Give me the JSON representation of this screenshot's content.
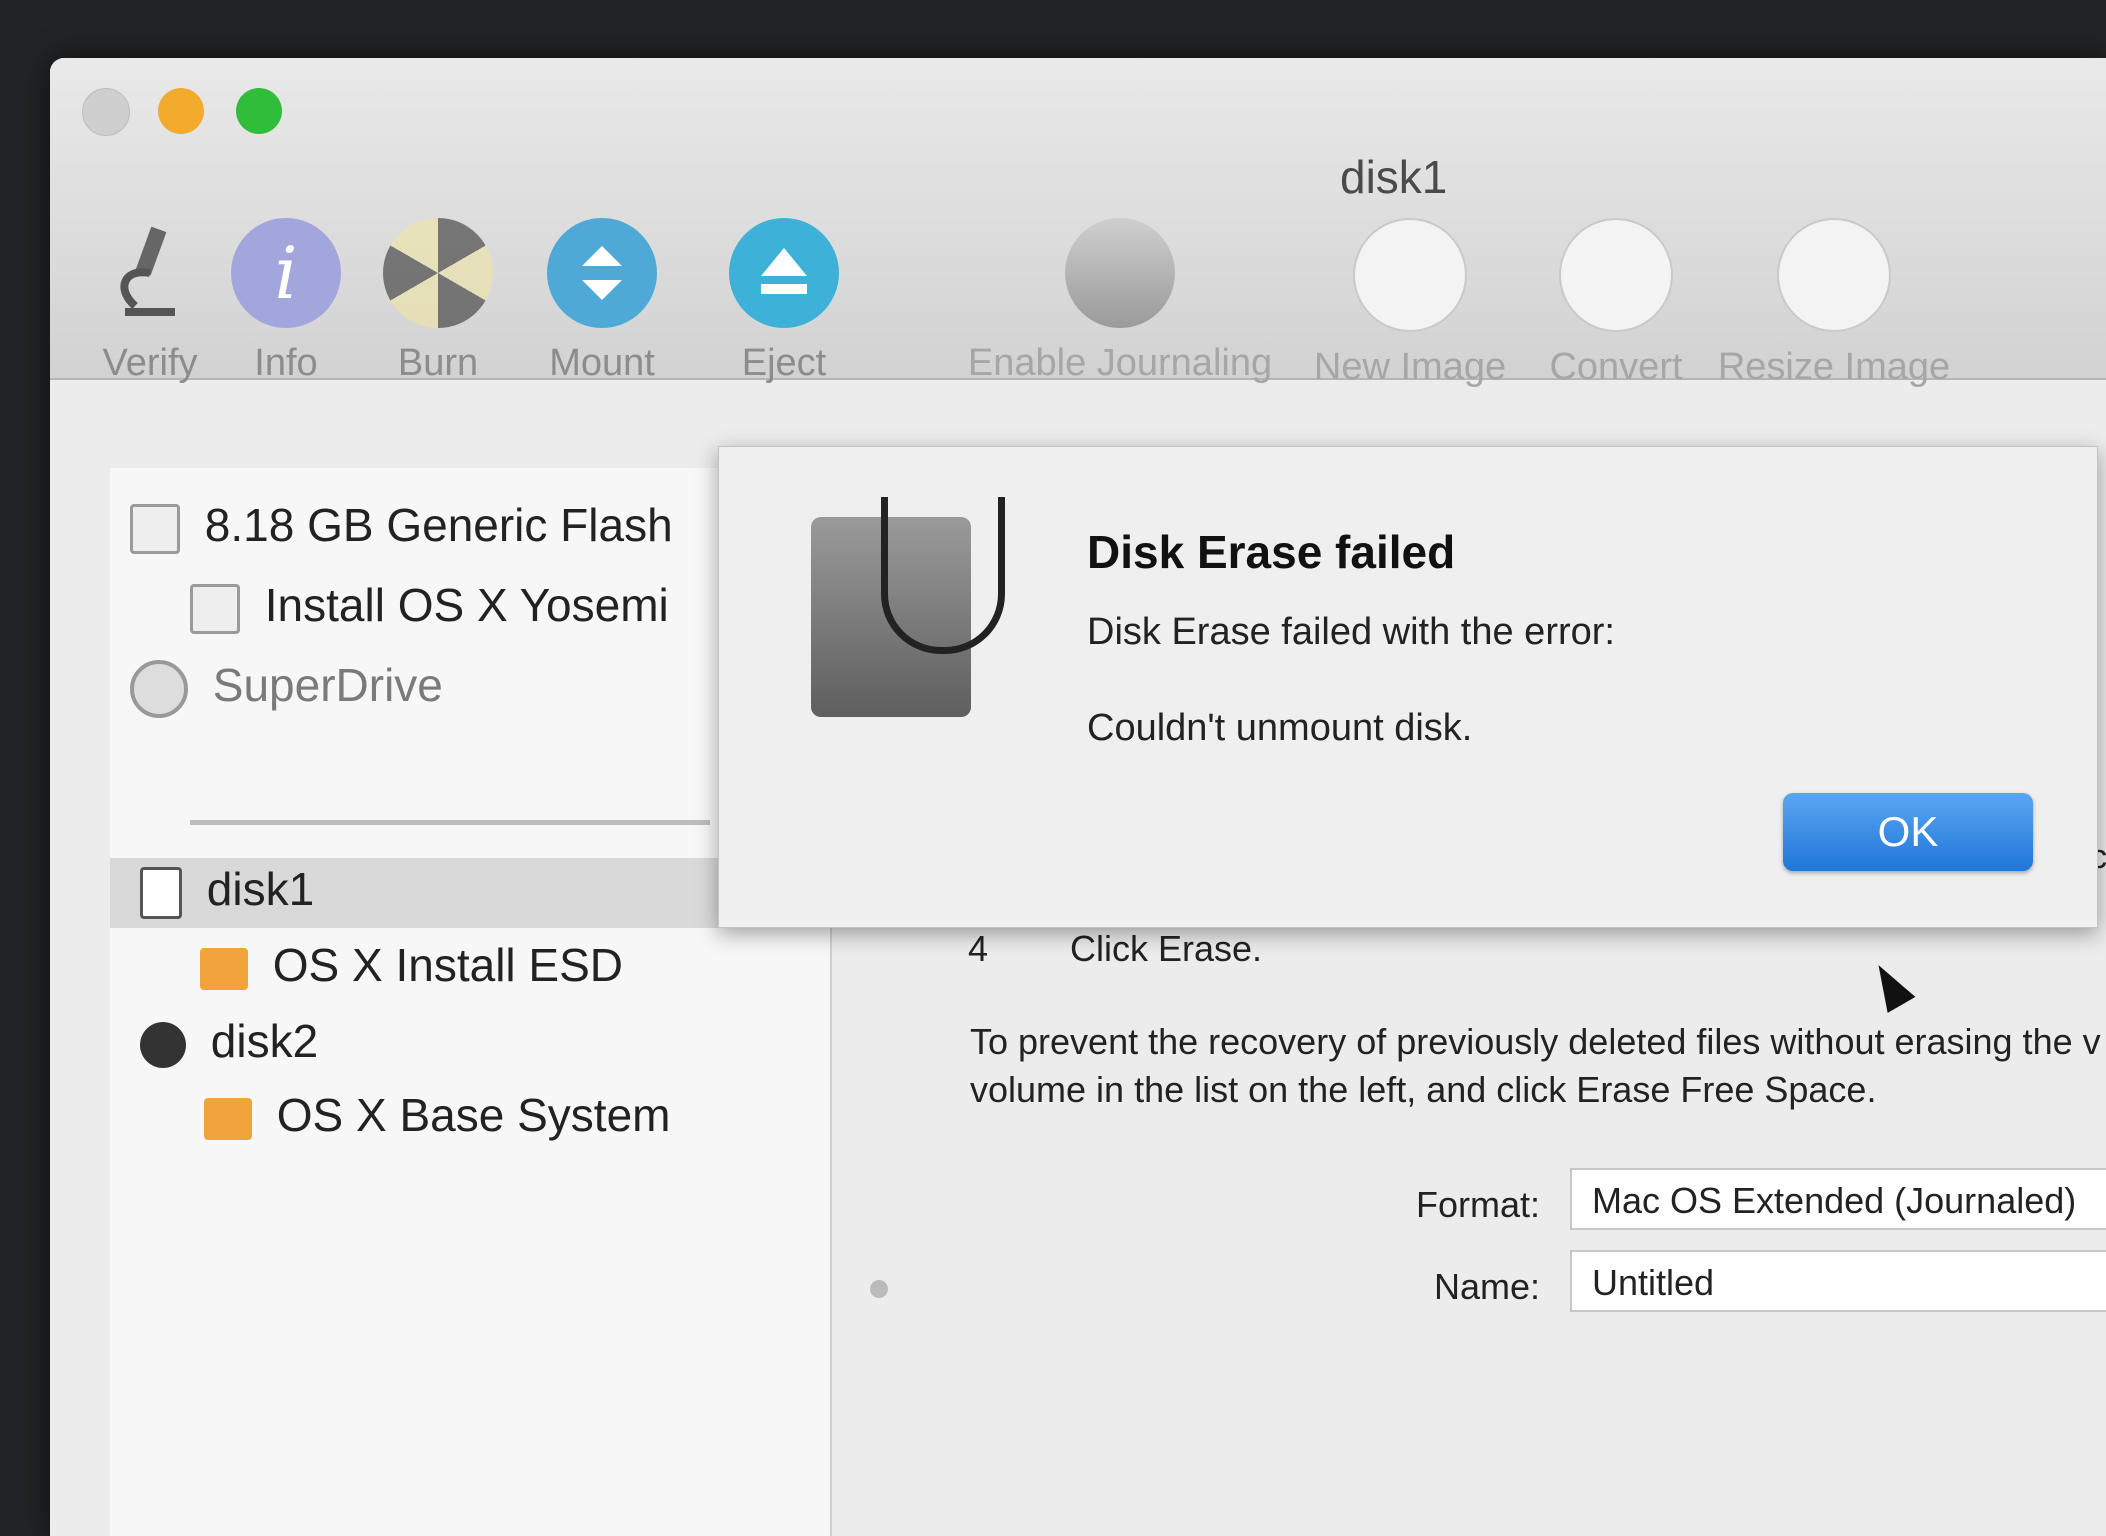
{
  "window": {
    "title": "disk1"
  },
  "toolbar": {
    "items": [
      {
        "label": "Verify",
        "icon": "microscope-icon"
      },
      {
        "label": "Info",
        "icon": "info-icon"
      },
      {
        "label": "Burn",
        "icon": "burn-icon"
      },
      {
        "label": "Mount",
        "icon": "mount-icon"
      },
      {
        "label": "Eject",
        "icon": "eject-icon"
      },
      {
        "label": "Enable Journaling",
        "icon": "journaling-icon"
      },
      {
        "label": "New Image",
        "icon": "new-image-icon"
      },
      {
        "label": "Convert",
        "icon": "convert-icon"
      },
      {
        "label": "Resize Image",
        "icon": "resize-image-icon"
      }
    ]
  },
  "sidebar": {
    "items": [
      {
        "label": "8.18 GB Generic Flash",
        "icon": "hard-drive-icon"
      },
      {
        "label": "Install OS X Yosemi",
        "icon": "hard-drive-icon"
      },
      {
        "label": "SuperDrive",
        "icon": "optical-disc-icon"
      },
      {
        "label": "disk1",
        "icon": "disk-image-icon"
      },
      {
        "label": "OS X Install ESD",
        "icon": "volume-icon"
      },
      {
        "label": "disk2",
        "icon": "globe-disk-icon"
      },
      {
        "label": "OS X Base System",
        "icon": "volume-icon"
      }
    ]
  },
  "main": {
    "step_number": "4",
    "step_text": "Click Erase.",
    "paragraph_line1": "To prevent the recovery of previously deleted files without erasing the v",
    "paragraph_line2": "volume in the list on the left, and click Erase Free Space.",
    "right_cut_text": "clic",
    "format_label": "Format:",
    "format_value": "Mac OS Extended (Journaled)",
    "name_label": "Name:",
    "name_value": "Untitled"
  },
  "dialog": {
    "title": "Disk Erase failed",
    "message_line1": "Disk Erase failed with the error:",
    "message_line2": "Couldn't unmount disk.",
    "ok_label": "OK",
    "ok_color": "#2a7fde"
  }
}
